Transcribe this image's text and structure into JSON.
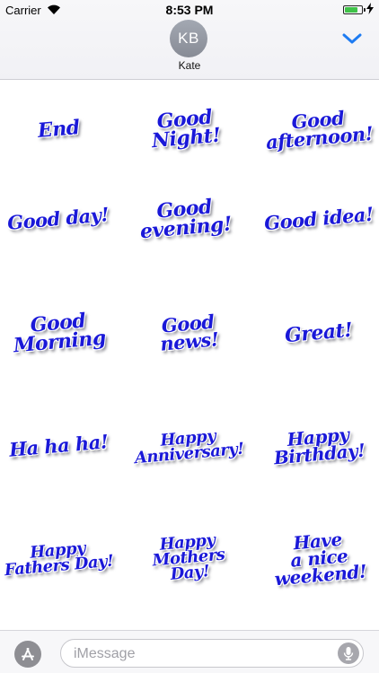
{
  "status_bar": {
    "carrier": "Carrier",
    "time": "8:53 PM",
    "battery_level": 0.75
  },
  "conversation": {
    "avatar_initials": "KB",
    "contact_name": "Kate"
  },
  "colors": {
    "sticker_text": "#1a18d8",
    "accent": "#1e7cf2",
    "battery": "#3fc248"
  },
  "icons": {
    "collapse": "chevron-down-icon",
    "app_store": "app-store-icon",
    "mic": "microphone-icon",
    "wifi": "wifi-icon",
    "charging": "bolt-icon"
  },
  "stickers": [
    "End",
    "Good\nNight!",
    "Good\nafternoon!",
    "Good day!",
    "Good\nevening!",
    "Good idea!",
    "Good\nMorning",
    "Good news!",
    "Great!",
    "Ha ha ha!",
    "Happy\nAnniversary!",
    "Happy\nBirthday!",
    "Happy\nFathers Day!",
    "Happy\nMothers Day!",
    "Have\na nice\nweekend!"
  ],
  "input_bar": {
    "placeholder": "iMessage"
  }
}
